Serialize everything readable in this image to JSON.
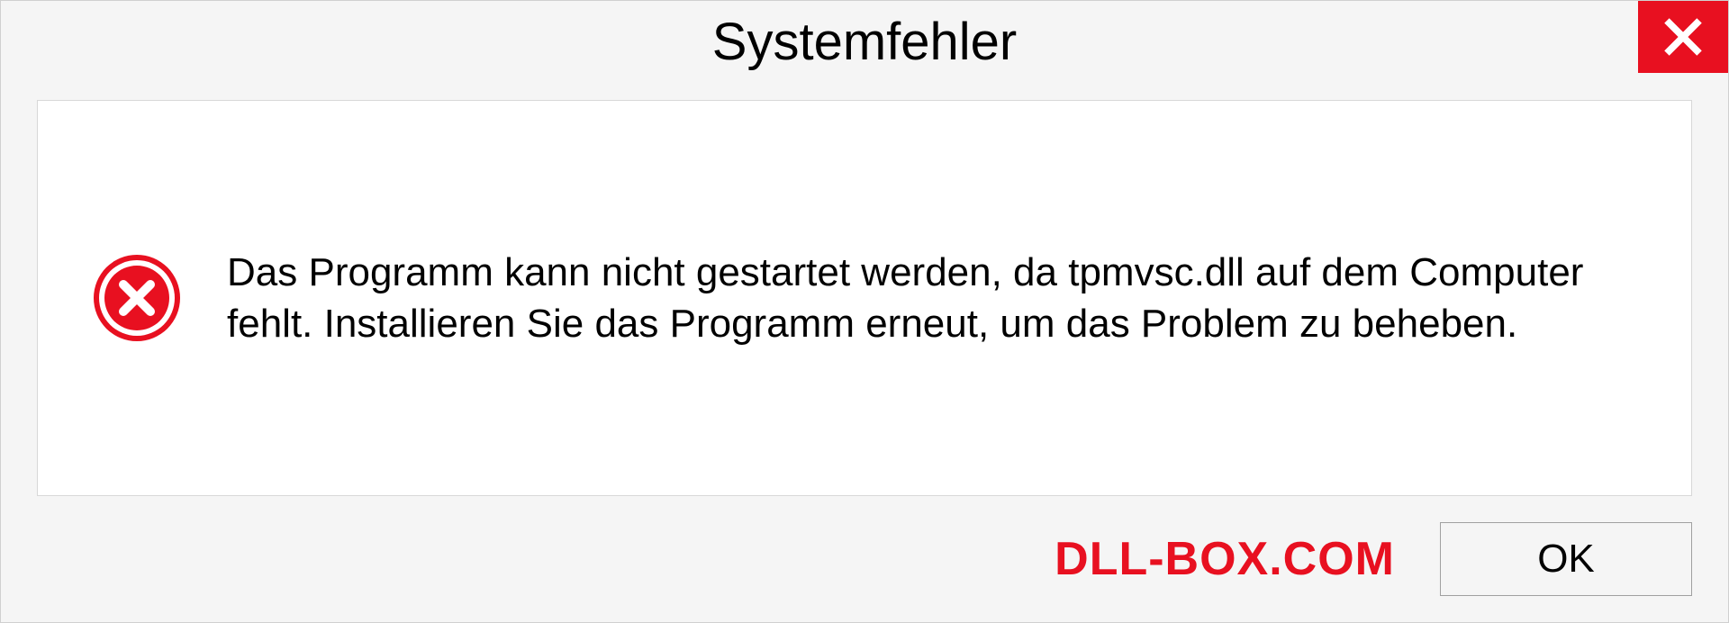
{
  "dialog": {
    "title": "Systemfehler",
    "message": "Das Programm kann nicht gestartet werden, da tpmvsc.dll auf dem Computer fehlt. Installieren Sie das Programm erneut, um das Problem zu beheben.",
    "ok_label": "OK"
  },
  "watermark": "DLL-BOX.COM"
}
